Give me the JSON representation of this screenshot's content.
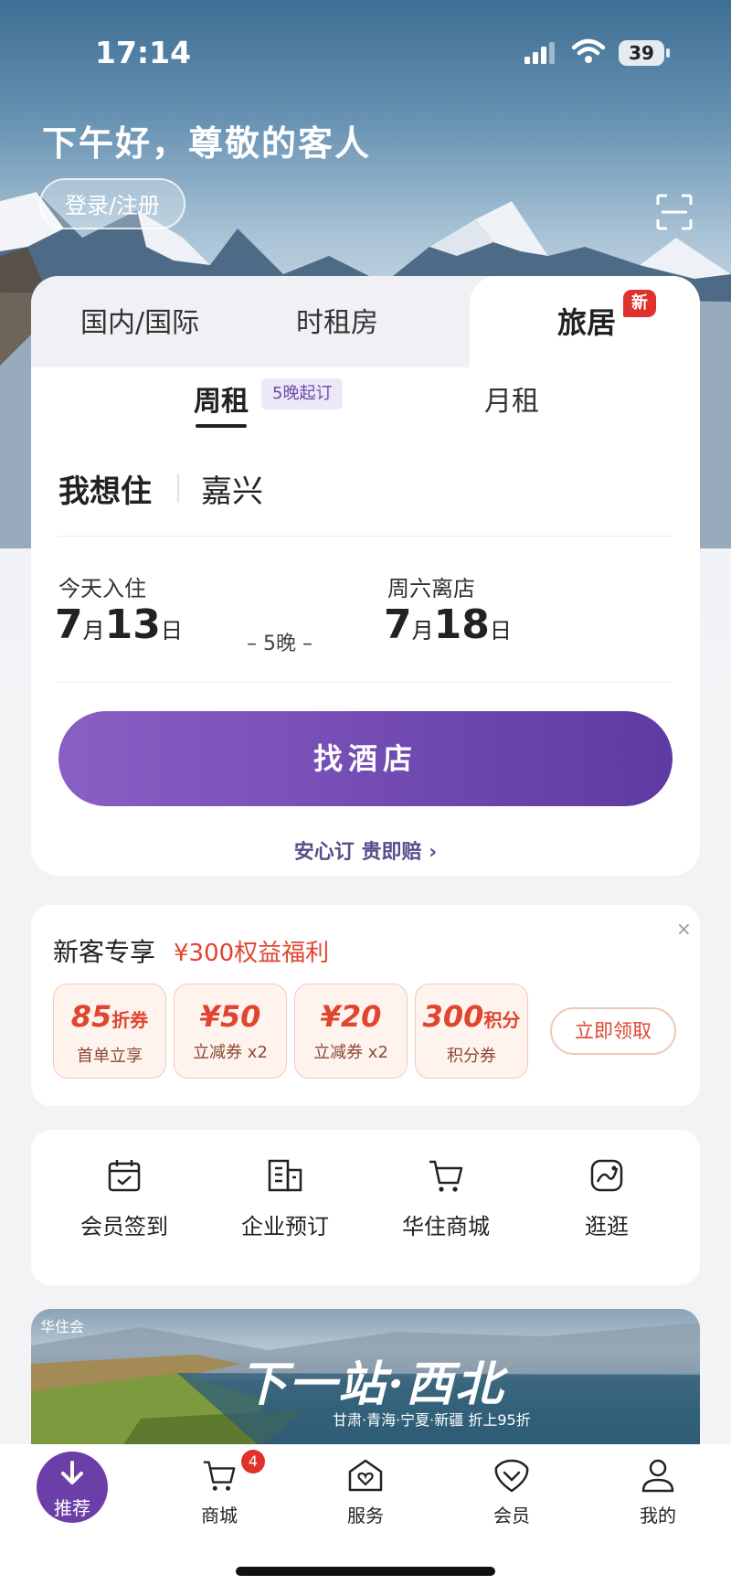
{
  "status_bar": {
    "time": "17:14",
    "battery": "39"
  },
  "header": {
    "greeting": "下午好，尊敬的客人",
    "login_label": "登录/注册"
  },
  "booking": {
    "tabs": [
      {
        "label": "国内/国际"
      },
      {
        "label": "时租房"
      },
      {
        "label": "旅居",
        "badge": "新",
        "active": true
      }
    ],
    "subtabs": [
      {
        "label": "周租",
        "badge": "5晚起订",
        "active": true
      },
      {
        "label": "月租"
      }
    ],
    "destination_label": "我想住",
    "destination_value": "嘉兴",
    "checkin": {
      "label": "今天入住",
      "month": "7",
      "month_unit": "月",
      "day": "13",
      "day_unit": "日"
    },
    "checkout": {
      "label": "周六离店",
      "month": "7",
      "month_unit": "月",
      "day": "18",
      "day_unit": "日"
    },
    "nights": "– 5晚 –",
    "search_button": "找酒店",
    "assurance_link": "安心订 贵即赔 ›"
  },
  "promo": {
    "title": "新客专享",
    "subtitle": "¥300权益福利",
    "coupons": [
      {
        "value": "85",
        "unit": "折券",
        "desc": "首单立享"
      },
      {
        "value": "¥50",
        "unit": "",
        "desc": "立减券 x2"
      },
      {
        "value": "¥20",
        "unit": "",
        "desc": "立减券 x2"
      },
      {
        "value": "300",
        "unit": "积分",
        "desc": "积分券"
      }
    ],
    "claim_button": "立即领取",
    "close": "×"
  },
  "quick_actions": [
    {
      "label": "会员签到",
      "icon": "calendar-check-icon"
    },
    {
      "label": "企业预订",
      "icon": "building-icon"
    },
    {
      "label": "华住商城",
      "icon": "cart-icon"
    },
    {
      "label": "逛逛",
      "icon": "explore-icon"
    }
  ],
  "banner": {
    "logo": "华住会",
    "title": "下一站·西北",
    "subtitle": "甘肃·青海·宁夏·新疆 折上95折"
  },
  "bottom_nav": [
    {
      "label": "推荐",
      "icon": "download-arrow-icon",
      "active": true
    },
    {
      "label": "商城",
      "icon": "cart-icon",
      "badge": "4"
    },
    {
      "label": "服务",
      "icon": "service-house-icon"
    },
    {
      "label": "会员",
      "icon": "heart-shield-icon"
    },
    {
      "label": "我的",
      "icon": "user-icon"
    }
  ]
}
